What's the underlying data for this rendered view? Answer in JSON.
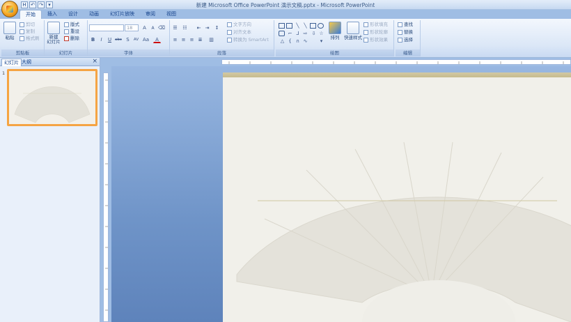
{
  "window": {
    "title": "新建 Microsoft Office PowerPoint 演示文稿.pptx - Microsoft PowerPoint"
  },
  "qat": {
    "save": "H",
    "undo": "↶",
    "redo": "↷",
    "custom": "▾"
  },
  "tabs": [
    "开始",
    "插入",
    "设计",
    "动画",
    "幻灯片放映",
    "审阅",
    "视图"
  ],
  "ribbon": {
    "clipboard": {
      "label": "剪贴板",
      "paste": "粘贴",
      "cut": "剪切",
      "copy": "复制",
      "format_painter": "格式刷"
    },
    "slides": {
      "label": "幻灯片",
      "new_slide": "新建\n幻灯片",
      "layout": "版式",
      "reset": "重设",
      "delete": "删除"
    },
    "font": {
      "label": "字体",
      "font_name": "",
      "font_size": "18",
      "bold": "B",
      "italic": "I",
      "underline": "U",
      "strike": "abc",
      "shadow": "S",
      "spacing": "AV",
      "case": "Aa",
      "grow": "A",
      "shrink": "A"
    },
    "paragraph": {
      "label": "段落",
      "text_direction": "文字方向",
      "align_text": "对齐文本",
      "convert_smartart": "转换为 SmartArt"
    },
    "drawing": {
      "label": "绘图",
      "arrange": "排列",
      "quick_styles": "快速样式",
      "shape_fill": "形状填充",
      "shape_outline": "形状轮廓",
      "shape_effects": "形状效果"
    },
    "editing": {
      "label": "编辑",
      "find": "查找",
      "replace": "替换",
      "select": "选择"
    }
  },
  "panel": {
    "tab_slides": "幻灯片",
    "tab_outline": "大纲",
    "close": "×",
    "slide_number": "1"
  },
  "colors": {
    "accent": "#f5a443",
    "ribbon": "#dbe7f7",
    "editor_bg": "#7a9dd0",
    "slide_bg": "#f1f0ea"
  }
}
